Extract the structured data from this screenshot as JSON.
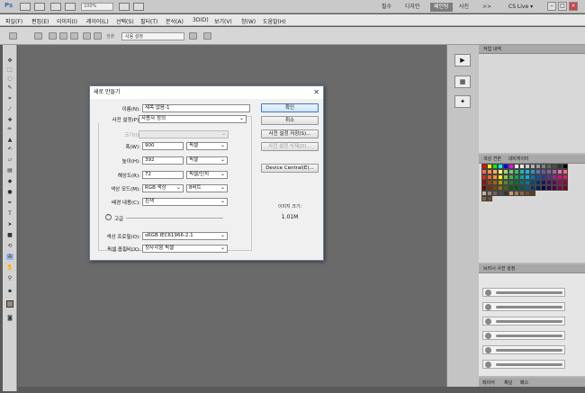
{
  "app": {
    "logo": "Ps",
    "zoom": "100%",
    "workspaces": [
      "필수",
      "디자인",
      "페인팅",
      "사진"
    ],
    "active_workspace": 2,
    "cs_live": "CS Live",
    "more": ">>"
  },
  "menus": [
    "파일(F)",
    "편집(E)",
    "이미지(I)",
    "레이어(L)",
    "선택(S)",
    "필터(T)",
    "분석(A)",
    "3D(D)",
    "보기(V)",
    "창(W)",
    "도움말(H)"
  ],
  "options": {
    "mode_label": "샘플",
    "sample_value": "사용 설정"
  },
  "panels": {
    "history_tab": "작업 내역",
    "swatches_tabs": [
      "색상 견본",
      "내비게이터"
    ],
    "brush_tab": "브러시 사전 설정",
    "bottom_tabs": [
      "레이어",
      "채널",
      "패스"
    ]
  },
  "dialog": {
    "title": "새로 만들기",
    "name_label": "이름(N):",
    "name_value": "제목 없음-1",
    "preset_label": "사전 설정(P):",
    "preset_value": "사용자 정의",
    "size_label": "크기(I):",
    "width_label": "폭(W):",
    "width_value": "900",
    "width_unit": "픽셀",
    "height_label": "높이(H):",
    "height_value": "392",
    "height_unit": "픽셀",
    "res_label": "해상도(R):",
    "res_value": "72",
    "res_unit": "픽셀/인치",
    "color_label": "색상 모드(M):",
    "color_value": "RGB 색상",
    "bit_value": "8비트",
    "bg_label": "배경 내용(C):",
    "bg_value": "흰색",
    "advanced_label": "고급",
    "profile_label": "색상 프로필(O):",
    "profile_value": "sRGB IEC61966-2.1",
    "pixel_label": "픽셀 종횡비(X):",
    "pixel_value": "정사각형 픽셀",
    "ok": "확인",
    "cancel": "취소",
    "save_preset": "사전 설정 저장(S)...",
    "delete_preset": "사전 설정 삭제(D)...",
    "device_central": "Device Central(E)...",
    "image_size_label": "이미지 크기:",
    "image_size_value": "1.01M"
  }
}
